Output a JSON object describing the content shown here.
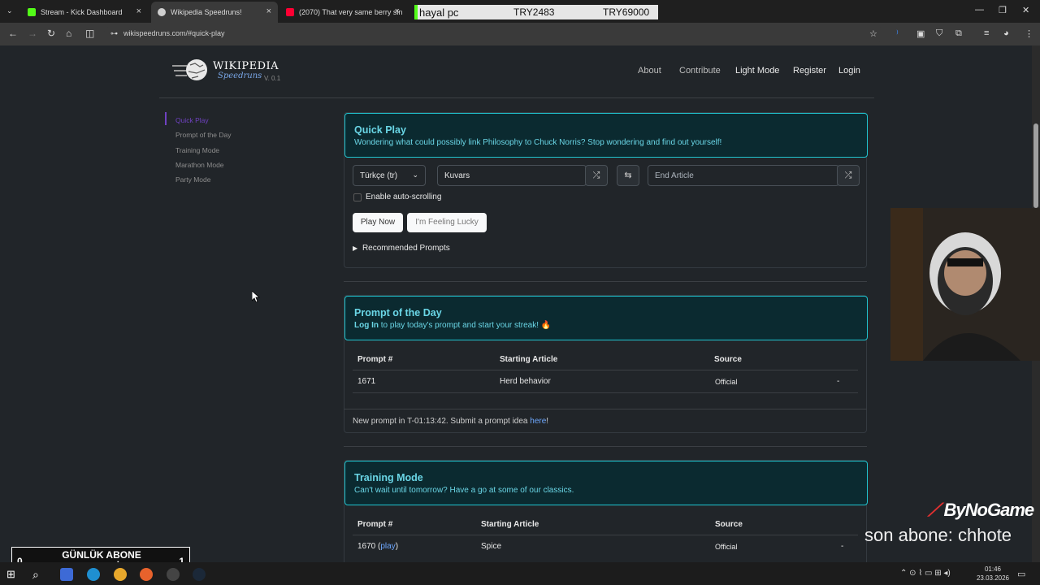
{
  "browser": {
    "tabs": [
      {
        "label": "Stream - Kick Dashboard",
        "favicon_color": "#53fc18"
      },
      {
        "label": "Wikipedia Speedruns!",
        "favicon_color": "#cfcfcf"
      },
      {
        "label": "(2070) That very same berry sin",
        "favicon_color": "#ff0033"
      }
    ],
    "url": "wikispeedruns.com/#quick-play",
    "overlay": {
      "name": "hayal pc",
      "price1": "TRY2483",
      "price2": "TRY69000"
    }
  },
  "site": {
    "logo_title": "WIKIPEDIA",
    "logo_sub": "Speedruns",
    "version": "V. 0.1",
    "nav": [
      "About",
      "Contribute",
      "Light Mode",
      "Register",
      "Login"
    ]
  },
  "sidebar": {
    "items": [
      {
        "label": "Quick Play",
        "active": true
      },
      {
        "label": "Prompt of the Day"
      },
      {
        "label": "Training Mode"
      },
      {
        "label": "Marathon Mode"
      },
      {
        "label": "Party Mode"
      }
    ]
  },
  "quick_play": {
    "title": "Quick Play",
    "subtitle": "Wondering what could possibly link Philosophy to Chuck Norris? Stop wondering and find out yourself!",
    "language": "Türkçe (tr)",
    "start_value": "Kuvars",
    "end_placeholder": "End Article",
    "autoscroll_label": "Enable auto-scrolling",
    "play_now": "Play Now",
    "lucky": "I'm Feeling Lucky",
    "recommended": "Recommended Prompts"
  },
  "prompt_of_day": {
    "title": "Prompt of the Day",
    "login_text": "Log In",
    "subtitle_rest": " to play today's prompt and start your streak! 🔥",
    "headers": [
      "Prompt #",
      "Starting Article",
      "Source"
    ],
    "rows": [
      {
        "num": "1671",
        "article": "Herd behavior",
        "source": "Official",
        "extra": "-"
      }
    ],
    "footer_prefix": "New prompt in T-01:13:42. Submit a prompt idea ",
    "footer_link": "here",
    "footer_suffix": "!"
  },
  "training": {
    "title": "Training Mode",
    "subtitle": "Can't wait until tomorrow? Have a go at some of our classics.",
    "headers": [
      "Prompt #",
      "Starting Article",
      "Source"
    ],
    "rows": [
      {
        "num": "1670",
        "play": "play",
        "article": "Spice",
        "source": "Official",
        "extra": "-"
      }
    ]
  },
  "stream": {
    "brand": "ByNoGame",
    "last_sub": "son abone: chhote",
    "goal_title": "GÜNLÜK ABONE HEDEFİ",
    "goal_left": "0",
    "goal_right": "1"
  },
  "taskbar": {
    "time": "01:46",
    "date": "23.03.2026"
  }
}
